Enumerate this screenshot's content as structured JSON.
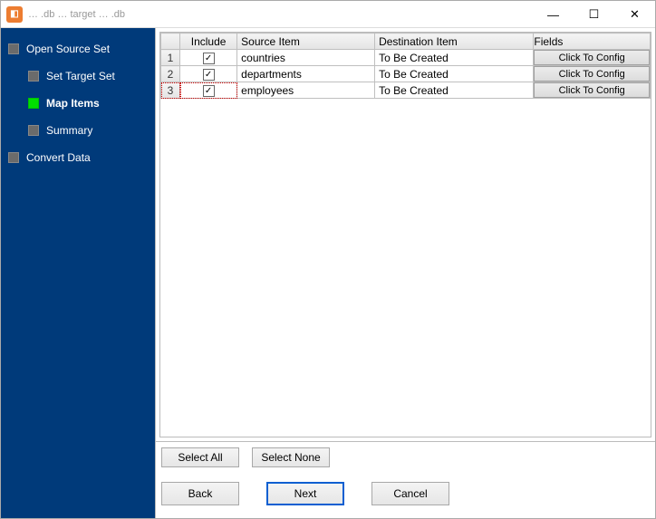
{
  "window": {
    "title": "… .db … target … .db"
  },
  "sidebar": {
    "steps": [
      {
        "label": "Open Source Set"
      },
      {
        "label": "Set Target Set"
      },
      {
        "label": "Map Items"
      },
      {
        "label": "Summary"
      },
      {
        "label": "Convert Data"
      }
    ],
    "active_index": 2
  },
  "grid": {
    "headers": {
      "include": "Include",
      "source": "Source Item",
      "dest": "Destination Item",
      "fields": "Fields"
    },
    "config_button_label": "Click To Config",
    "rows": [
      {
        "num": "1",
        "included": true,
        "source": "countries",
        "dest": "To Be Created"
      },
      {
        "num": "2",
        "included": true,
        "source": "departments",
        "dest": "To Be Created"
      },
      {
        "num": "3",
        "included": true,
        "source": "employees",
        "dest": "To Be Created"
      }
    ],
    "selected_row_index": 2
  },
  "buttons": {
    "select_all": "Select All",
    "select_none": "Select None",
    "back": "Back",
    "next": "Next",
    "cancel": "Cancel"
  }
}
